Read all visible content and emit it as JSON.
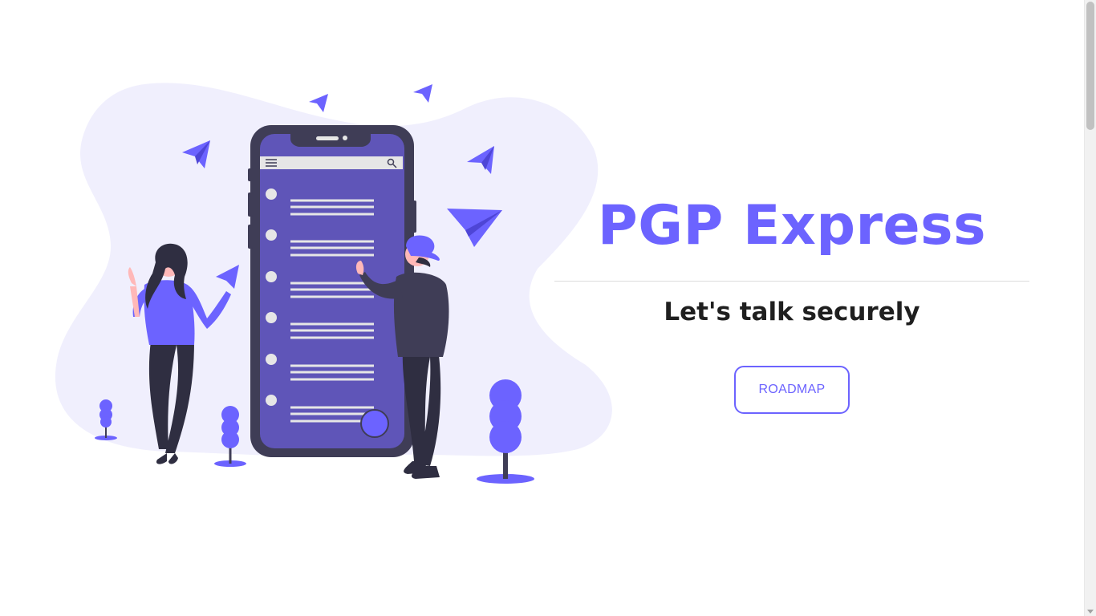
{
  "hero": {
    "title": "PGP Express",
    "subtitle": "Let's talk securely",
    "roadmap_button": "ROADMAP"
  },
  "illustration": {
    "icons": [
      "paper-plane-icon",
      "hamburger-menu-icon",
      "search-icon",
      "plant-icon"
    ]
  },
  "colors": {
    "accent": "#6c63ff",
    "blob": "#f0effd",
    "phone_frame": "#3f3d56",
    "phone_screen": "#5f55b8",
    "text_dark": "#1f1f1f"
  }
}
